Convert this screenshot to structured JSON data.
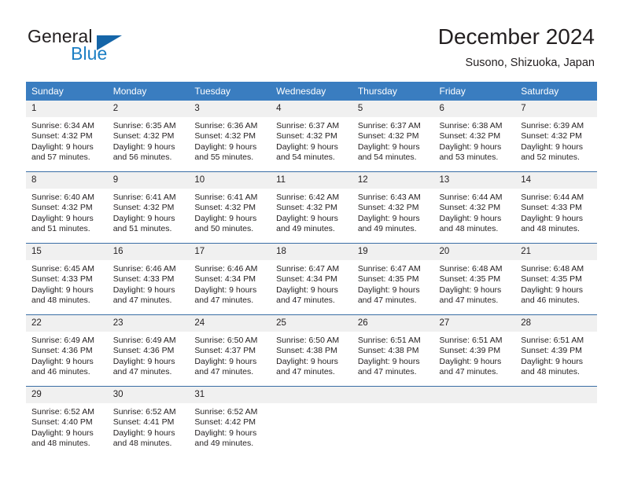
{
  "brand": {
    "name_top": "General",
    "name_bottom": "Blue",
    "flag_icon": "triangle-flag-icon",
    "accent_color": "#1c7fc4"
  },
  "header": {
    "title": "December 2024",
    "subtitle": "Susono, Shizuoka, Japan"
  },
  "calendar": {
    "header_color": "#3a7dc0",
    "daynum_band_color": "#f0f0f0",
    "row_divider_color": "#3a6ea5",
    "weekday_headers": [
      "Sunday",
      "Monday",
      "Tuesday",
      "Wednesday",
      "Thursday",
      "Friday",
      "Saturday"
    ],
    "weeks": [
      [
        {
          "day": "1",
          "sunrise": "Sunrise: 6:34 AM",
          "sunset": "Sunset: 4:32 PM",
          "daylight_line1": "Daylight: 9 hours",
          "daylight_line2": "and 57 minutes."
        },
        {
          "day": "2",
          "sunrise": "Sunrise: 6:35 AM",
          "sunset": "Sunset: 4:32 PM",
          "daylight_line1": "Daylight: 9 hours",
          "daylight_line2": "and 56 minutes."
        },
        {
          "day": "3",
          "sunrise": "Sunrise: 6:36 AM",
          "sunset": "Sunset: 4:32 PM",
          "daylight_line1": "Daylight: 9 hours",
          "daylight_line2": "and 55 minutes."
        },
        {
          "day": "4",
          "sunrise": "Sunrise: 6:37 AM",
          "sunset": "Sunset: 4:32 PM",
          "daylight_line1": "Daylight: 9 hours",
          "daylight_line2": "and 54 minutes."
        },
        {
          "day": "5",
          "sunrise": "Sunrise: 6:37 AM",
          "sunset": "Sunset: 4:32 PM",
          "daylight_line1": "Daylight: 9 hours",
          "daylight_line2": "and 54 minutes."
        },
        {
          "day": "6",
          "sunrise": "Sunrise: 6:38 AM",
          "sunset": "Sunset: 4:32 PM",
          "daylight_line1": "Daylight: 9 hours",
          "daylight_line2": "and 53 minutes."
        },
        {
          "day": "7",
          "sunrise": "Sunrise: 6:39 AM",
          "sunset": "Sunset: 4:32 PM",
          "daylight_line1": "Daylight: 9 hours",
          "daylight_line2": "and 52 minutes."
        }
      ],
      [
        {
          "day": "8",
          "sunrise": "Sunrise: 6:40 AM",
          "sunset": "Sunset: 4:32 PM",
          "daylight_line1": "Daylight: 9 hours",
          "daylight_line2": "and 51 minutes."
        },
        {
          "day": "9",
          "sunrise": "Sunrise: 6:41 AM",
          "sunset": "Sunset: 4:32 PM",
          "daylight_line1": "Daylight: 9 hours",
          "daylight_line2": "and 51 minutes."
        },
        {
          "day": "10",
          "sunrise": "Sunrise: 6:41 AM",
          "sunset": "Sunset: 4:32 PM",
          "daylight_line1": "Daylight: 9 hours",
          "daylight_line2": "and 50 minutes."
        },
        {
          "day": "11",
          "sunrise": "Sunrise: 6:42 AM",
          "sunset": "Sunset: 4:32 PM",
          "daylight_line1": "Daylight: 9 hours",
          "daylight_line2": "and 49 minutes."
        },
        {
          "day": "12",
          "sunrise": "Sunrise: 6:43 AM",
          "sunset": "Sunset: 4:32 PM",
          "daylight_line1": "Daylight: 9 hours",
          "daylight_line2": "and 49 minutes."
        },
        {
          "day": "13",
          "sunrise": "Sunrise: 6:44 AM",
          "sunset": "Sunset: 4:32 PM",
          "daylight_line1": "Daylight: 9 hours",
          "daylight_line2": "and 48 minutes."
        },
        {
          "day": "14",
          "sunrise": "Sunrise: 6:44 AM",
          "sunset": "Sunset: 4:33 PM",
          "daylight_line1": "Daylight: 9 hours",
          "daylight_line2": "and 48 minutes."
        }
      ],
      [
        {
          "day": "15",
          "sunrise": "Sunrise: 6:45 AM",
          "sunset": "Sunset: 4:33 PM",
          "daylight_line1": "Daylight: 9 hours",
          "daylight_line2": "and 48 minutes."
        },
        {
          "day": "16",
          "sunrise": "Sunrise: 6:46 AM",
          "sunset": "Sunset: 4:33 PM",
          "daylight_line1": "Daylight: 9 hours",
          "daylight_line2": "and 47 minutes."
        },
        {
          "day": "17",
          "sunrise": "Sunrise: 6:46 AM",
          "sunset": "Sunset: 4:34 PM",
          "daylight_line1": "Daylight: 9 hours",
          "daylight_line2": "and 47 minutes."
        },
        {
          "day": "18",
          "sunrise": "Sunrise: 6:47 AM",
          "sunset": "Sunset: 4:34 PM",
          "daylight_line1": "Daylight: 9 hours",
          "daylight_line2": "and 47 minutes."
        },
        {
          "day": "19",
          "sunrise": "Sunrise: 6:47 AM",
          "sunset": "Sunset: 4:35 PM",
          "daylight_line1": "Daylight: 9 hours",
          "daylight_line2": "and 47 minutes."
        },
        {
          "day": "20",
          "sunrise": "Sunrise: 6:48 AM",
          "sunset": "Sunset: 4:35 PM",
          "daylight_line1": "Daylight: 9 hours",
          "daylight_line2": "and 47 minutes."
        },
        {
          "day": "21",
          "sunrise": "Sunrise: 6:48 AM",
          "sunset": "Sunset: 4:35 PM",
          "daylight_line1": "Daylight: 9 hours",
          "daylight_line2": "and 46 minutes."
        }
      ],
      [
        {
          "day": "22",
          "sunrise": "Sunrise: 6:49 AM",
          "sunset": "Sunset: 4:36 PM",
          "daylight_line1": "Daylight: 9 hours",
          "daylight_line2": "and 46 minutes."
        },
        {
          "day": "23",
          "sunrise": "Sunrise: 6:49 AM",
          "sunset": "Sunset: 4:36 PM",
          "daylight_line1": "Daylight: 9 hours",
          "daylight_line2": "and 47 minutes."
        },
        {
          "day": "24",
          "sunrise": "Sunrise: 6:50 AM",
          "sunset": "Sunset: 4:37 PM",
          "daylight_line1": "Daylight: 9 hours",
          "daylight_line2": "and 47 minutes."
        },
        {
          "day": "25",
          "sunrise": "Sunrise: 6:50 AM",
          "sunset": "Sunset: 4:38 PM",
          "daylight_line1": "Daylight: 9 hours",
          "daylight_line2": "and 47 minutes."
        },
        {
          "day": "26",
          "sunrise": "Sunrise: 6:51 AM",
          "sunset": "Sunset: 4:38 PM",
          "daylight_line1": "Daylight: 9 hours",
          "daylight_line2": "and 47 minutes."
        },
        {
          "day": "27",
          "sunrise": "Sunrise: 6:51 AM",
          "sunset": "Sunset: 4:39 PM",
          "daylight_line1": "Daylight: 9 hours",
          "daylight_line2": "and 47 minutes."
        },
        {
          "day": "28",
          "sunrise": "Sunrise: 6:51 AM",
          "sunset": "Sunset: 4:39 PM",
          "daylight_line1": "Daylight: 9 hours",
          "daylight_line2": "and 48 minutes."
        }
      ],
      [
        {
          "day": "29",
          "sunrise": "Sunrise: 6:52 AM",
          "sunset": "Sunset: 4:40 PM",
          "daylight_line1": "Daylight: 9 hours",
          "daylight_line2": "and 48 minutes."
        },
        {
          "day": "30",
          "sunrise": "Sunrise: 6:52 AM",
          "sunset": "Sunset: 4:41 PM",
          "daylight_line1": "Daylight: 9 hours",
          "daylight_line2": "and 48 minutes."
        },
        {
          "day": "31",
          "sunrise": "Sunrise: 6:52 AM",
          "sunset": "Sunset: 4:42 PM",
          "daylight_line1": "Daylight: 9 hours",
          "daylight_line2": "and 49 minutes."
        },
        {
          "day": "",
          "sunrise": "",
          "sunset": "",
          "daylight_line1": "",
          "daylight_line2": ""
        },
        {
          "day": "",
          "sunrise": "",
          "sunset": "",
          "daylight_line1": "",
          "daylight_line2": ""
        },
        {
          "day": "",
          "sunrise": "",
          "sunset": "",
          "daylight_line1": "",
          "daylight_line2": ""
        },
        {
          "day": "",
          "sunrise": "",
          "sunset": "",
          "daylight_line1": "",
          "daylight_line2": ""
        }
      ]
    ]
  }
}
